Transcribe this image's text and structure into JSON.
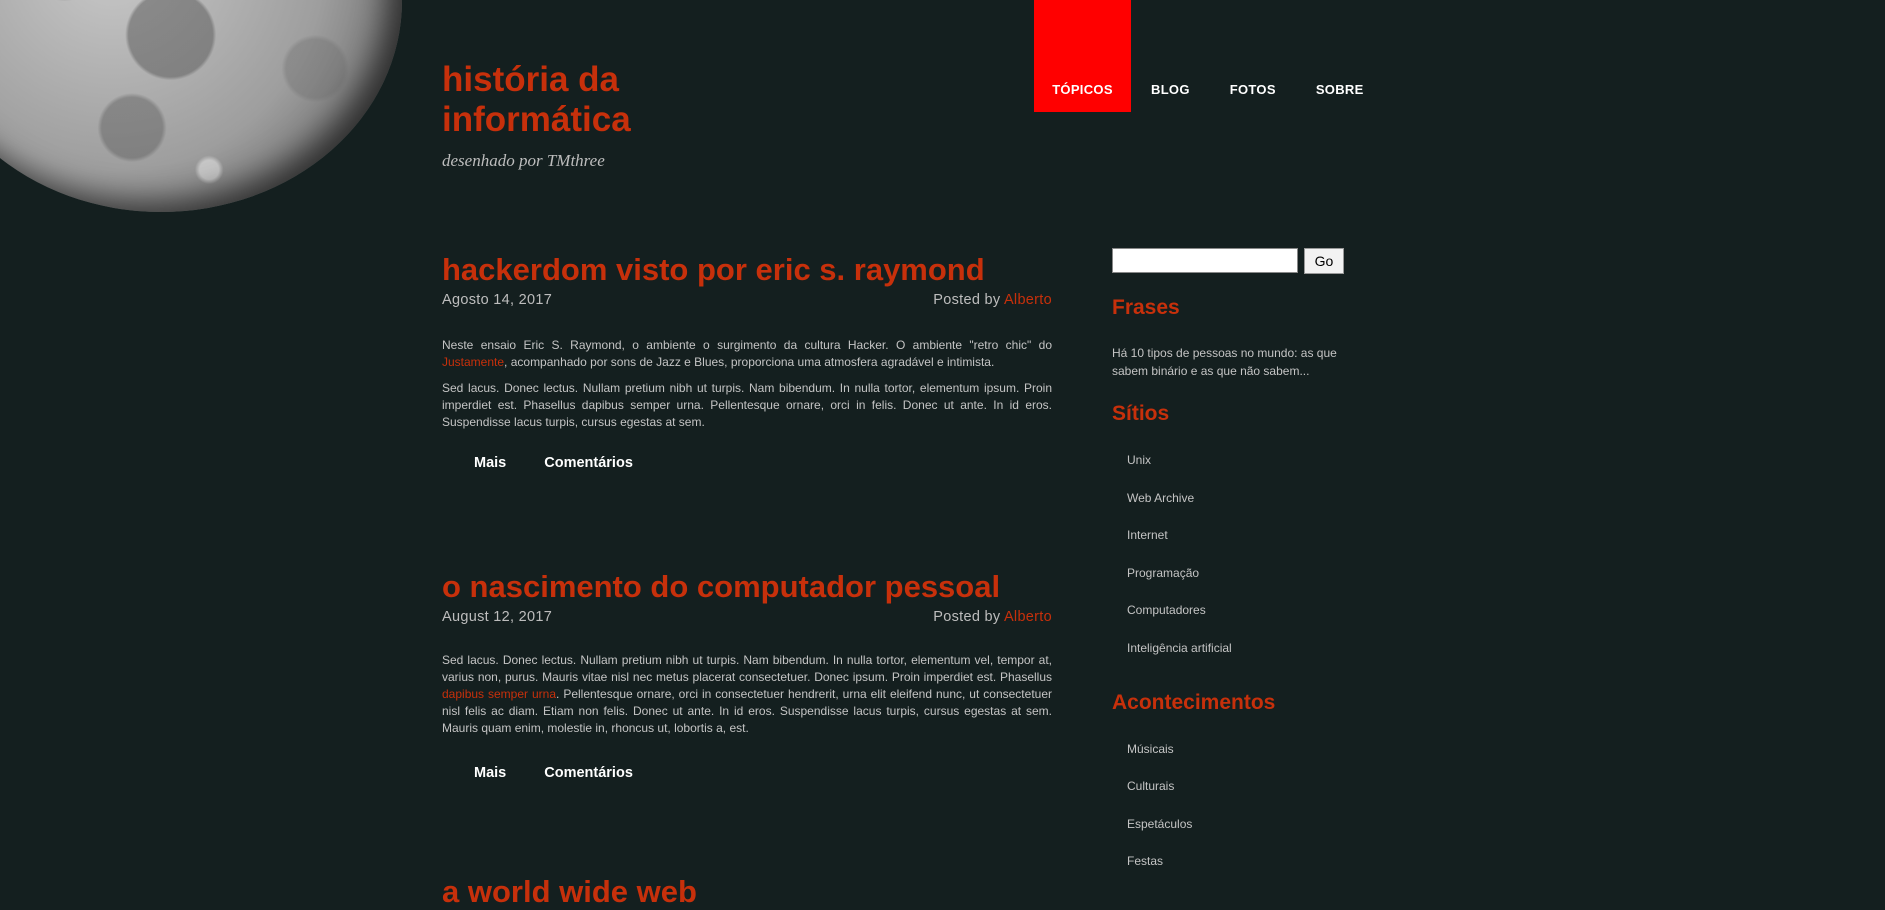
{
  "site": {
    "title": "história da informática",
    "tagline": "desenhado por TMthree"
  },
  "nav": {
    "items": [
      {
        "label": "TÓPICOS"
      },
      {
        "label": "BLOG"
      },
      {
        "label": "FOTOS"
      },
      {
        "label": "SOBRE"
      }
    ],
    "active_color": "#ff0000"
  },
  "posts": [
    {
      "title": "hackerdom visto por eric s. raymond",
      "date": "Agosto 14, 2017",
      "posted_by": "Posted by ",
      "author": "Alberto",
      "p1_before": "Neste ensaio Eric S. Raymond, o ambiente o surgimento da cultura Hacker. O ambiente \"retro chic\" do ",
      "p1_link": "Justamente",
      "p1_after": ", acompanhado por sons de Jazz e Blues, proporciona uma atmosfera agradável e intimista.",
      "p2": "Sed lacus. Donec lectus. Nullam pretium nibh ut turpis. Nam bibendum. In nulla tortor, elementum ipsum. Proin imperdiet est. Phasellus dapibus semper urna. Pellentesque ornare, orci in felis. Donec ut ante. In id eros. Suspendisse lacus turpis, cursus egestas at sem.",
      "more": "Mais",
      "comments": "Comentários"
    },
    {
      "title": "o nascimento do computador pessoal",
      "date": "August 12, 2017",
      "posted_by": "Posted by ",
      "author": "Alberto",
      "p1_before": "Sed lacus. Donec lectus. Nullam pretium nibh ut turpis. Nam bibendum. In nulla tortor, elementum vel, tempor at, varius non, purus. Mauris vitae nisl nec metus placerat consectetuer. Donec ipsum. Proin imperdiet est. Phasellus ",
      "p1_link": "dapibus semper urna",
      "p1_after": ". Pellentesque ornare, orci in consectetuer hendrerit, urna elit eleifend nunc, ut consectetuer nisl felis ac diam. Etiam non felis. Donec ut ante. In id eros. Suspendisse lacus turpis, cursus egestas at sem. Mauris quam enim, molestie in, rhoncus ut, lobortis a, est.",
      "more": "Mais",
      "comments": "Comentários"
    },
    {
      "title": "a world wide web"
    }
  ],
  "sidebar": {
    "search": {
      "value": "",
      "button": "Go"
    },
    "frases": {
      "heading": "Frases",
      "text": "Há 10 tipos de pessoas no mundo: as que sabem binário e as que não sabem..."
    },
    "sitios": {
      "heading": "Sítios",
      "items": [
        "Unix",
        "Web Archive",
        "Internet",
        "Programação",
        "Computadores",
        "Inteligência artificial"
      ]
    },
    "acontecimentos": {
      "heading": "Acontecimentos",
      "items": [
        "Músicais",
        "Culturais",
        "Espetáculos",
        "Festas"
      ]
    }
  },
  "colors": {
    "background": "#141f1f",
    "accent": "#c7300b"
  }
}
